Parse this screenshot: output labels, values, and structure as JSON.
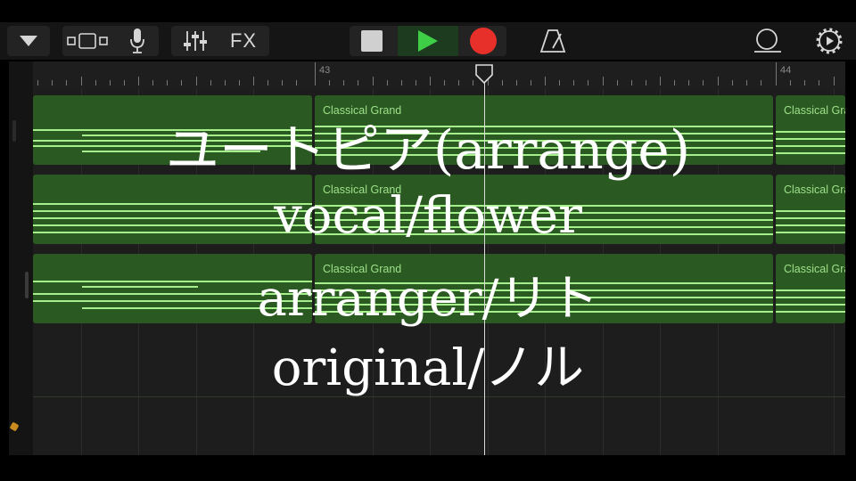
{
  "toolbar": {
    "icons": [
      "browser-dropdown-icon",
      "tracks-view-icon",
      "microphone-icon",
      "mixer-icon",
      "stop-icon",
      "play-icon",
      "record-icon",
      "metronome-icon",
      "loop-icon",
      "settings-icon"
    ],
    "fx_label": "FX",
    "colors": {
      "play": "#3fcf47",
      "record": "#e8302a",
      "stop": "#d0d0d0"
    }
  },
  "ruler": {
    "bar_43": "43",
    "bar_44": "44"
  },
  "regions": {
    "name": "Classical Grand",
    "r1": "Classical Grand",
    "r2": "Classical Grand",
    "r3": "Classical Grand",
    "r4": "Classical Grand",
    "r5": "Classical Grand",
    "r6": "Classical Grand",
    "color": "#2a5a22",
    "note_color": "#a6f08c"
  },
  "overlay": {
    "line1": "ユートピア(arrange)",
    "line2": "vocal/flower",
    "line3": "arranger/リト",
    "line4": "original/ノル"
  }
}
